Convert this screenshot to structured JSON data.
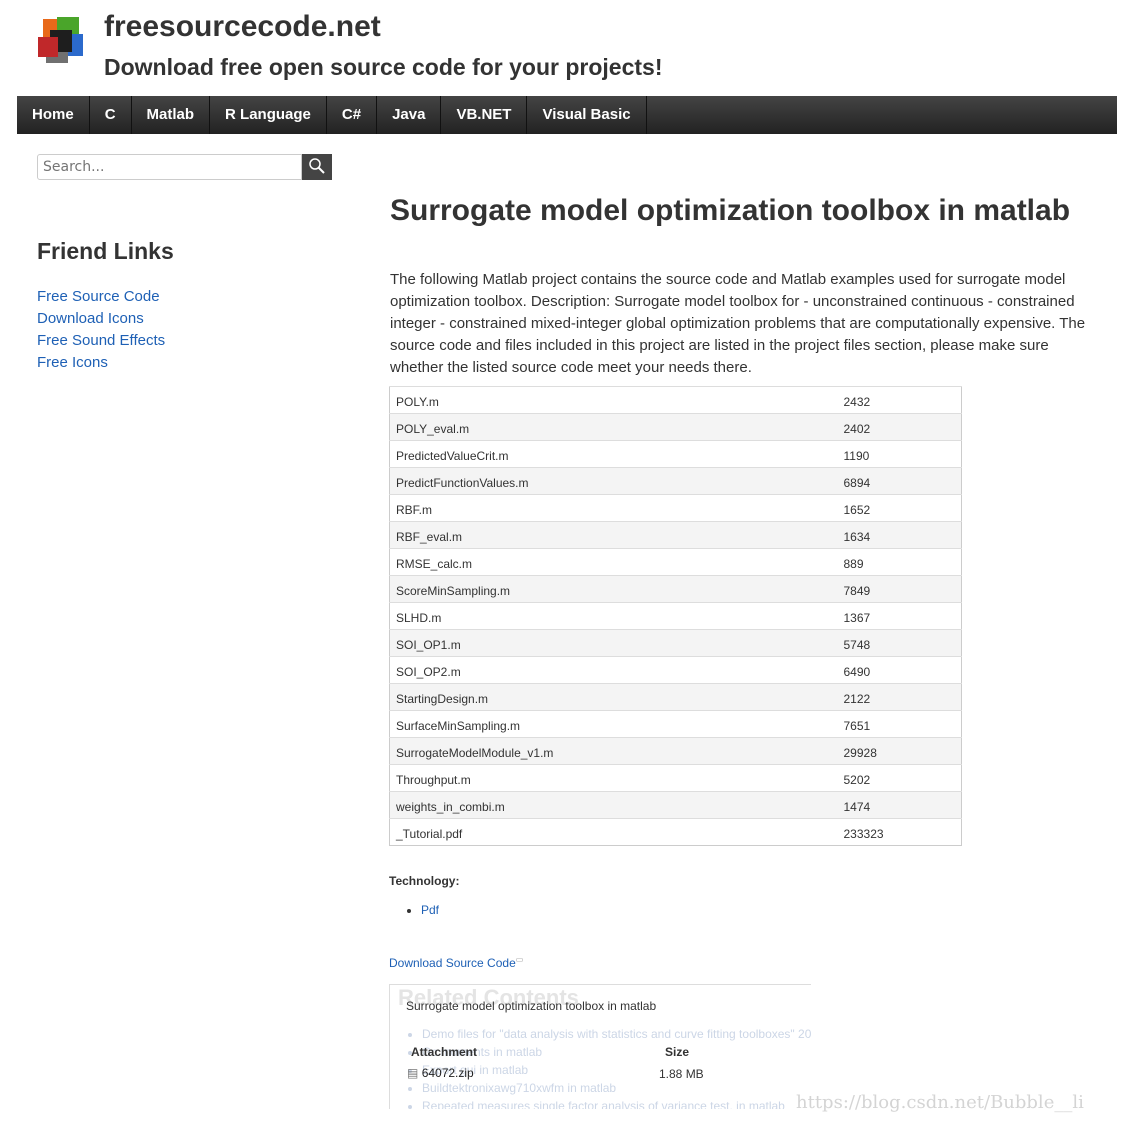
{
  "header": {
    "site_title": "freesourcecode.net",
    "tagline": "Download free open source code for your projects!",
    "logo_colors": [
      "#e8691a",
      "#4aa52a",
      "#2b6acc",
      "#c0282a",
      "#1e1e1e",
      "#707070"
    ]
  },
  "nav": [
    "Home",
    "C",
    "Matlab",
    "R Language",
    "C#",
    "Java",
    "VB.NET",
    "Visual Basic"
  ],
  "search": {
    "placeholder": "Search..."
  },
  "sidebar": {
    "title": "Friend Links",
    "links": [
      "Free Source Code",
      "Download Icons",
      "Free Sound Effects",
      "Free Icons"
    ]
  },
  "main": {
    "title": "Surrogate model optimization toolbox in matlab",
    "description": "The following Matlab project contains the source code and Matlab examples used for surrogate model optimization toolbox. Description: Surrogate model toolbox for - unconstrained continuous - constrained integer - constrained mixed-integer global optimization problems that are computationally expensive. The source code and files included in this project are listed in the project files section, please make sure whether the listed source code meet your needs there.",
    "files": [
      [
        "POLY.m",
        "2432"
      ],
      [
        "POLY_eval.m",
        "2402"
      ],
      [
        "PredictedValueCrit.m",
        "1190"
      ],
      [
        "PredictFunctionValues.m",
        "6894"
      ],
      [
        "RBF.m",
        "1652"
      ],
      [
        "RBF_eval.m",
        "1634"
      ],
      [
        "RMSE_calc.m",
        "889"
      ],
      [
        "ScoreMinSampling.m",
        "7849"
      ],
      [
        "SLHD.m",
        "1367"
      ],
      [
        "SOI_OP1.m",
        "5748"
      ],
      [
        "SOI_OP2.m",
        "6490"
      ],
      [
        "StartingDesign.m",
        "2122"
      ],
      [
        "SurfaceMinSampling.m",
        "7651"
      ],
      [
        "SurrogateModelModule_v1.m",
        "29928"
      ],
      [
        "Throughput.m",
        "5202"
      ],
      [
        "weights_in_combi.m",
        "1474"
      ],
      [
        "_Tutorial.pdf",
        "233323"
      ]
    ],
    "technology_label": "Technology:",
    "technologies": [
      "Pdf"
    ],
    "download_label": "Download Source Code"
  },
  "popup": {
    "related_title": "Related Contents",
    "related": [
      "Demo files for \"data analysis with statistics and curve fitting toolboxes\" 20",
      "Gc moments in matlab",
      "Export gui in matlab",
      "Buildtektronixawg710xwfm in matlab",
      "Repeated measures single factor analysis of variance test, in matlab"
    ],
    "title": "Surrogate model optimization toolbox in matlab",
    "attachment_header": "Attachment",
    "size_header": "Size",
    "file_name": "64072.zip",
    "file_size": "1.88 MB"
  },
  "watermark": "https://blog.csdn.net/Bubble__li"
}
